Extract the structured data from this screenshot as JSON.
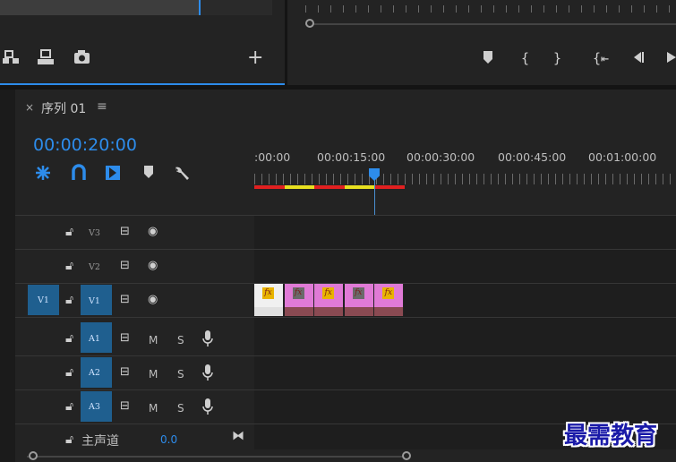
{
  "source_panel": {
    "toolbar_icons": [
      "insert-icon",
      "overwrite-icon",
      "export-frame-icon",
      "add-button-icon"
    ]
  },
  "program_panel": {
    "controls": [
      "marker-icon",
      "mark-in-icon",
      "mark-out-icon",
      "go-to-in-icon",
      "step-back-icon",
      "play-icon"
    ]
  },
  "timeline": {
    "tab": {
      "close": "×",
      "title": "序列 01",
      "menu": "≡"
    },
    "timecode": "00:00:20:00",
    "tools": [
      "nest-icon",
      "snap-icon",
      "linked-selection-icon",
      "add-marker-icon",
      "wrench-icon"
    ],
    "ruler_labels": [
      ":00:00",
      "00:00:15:00",
      "00:00:30:00",
      "00:00:45:00",
      "00:01:00:00"
    ],
    "playhead_time": "00:00:20:00",
    "video_tracks": [
      {
        "name": "V3",
        "source": ""
      },
      {
        "name": "V2",
        "source": ""
      },
      {
        "name": "V1",
        "source": "V1"
      }
    ],
    "audio_tracks": [
      {
        "name": "A1",
        "mute": "M",
        "solo": "S"
      },
      {
        "name": "A2",
        "mute": "M",
        "solo": "S"
      },
      {
        "name": "A3",
        "mute": "M",
        "solo": "S"
      }
    ],
    "master": {
      "label": "主声道",
      "value": "0.0"
    },
    "clips": [
      {
        "fx": "fx",
        "color": "#f0f0f0",
        "badge": "#e8b400"
      },
      {
        "fx": "fx",
        "color": "#e07ad6",
        "badge": "#6a6a6a"
      },
      {
        "fx": "fx",
        "color": "#e07ad6",
        "badge": "#e8b400"
      },
      {
        "fx": "fx",
        "color": "#e07ad6",
        "badge": "#6a6a6a"
      },
      {
        "fx": "fx",
        "color": "#e07ad6",
        "badge": "#e8b400"
      }
    ],
    "render_bar_colors": [
      "#e02020",
      "#e8e020",
      "#e02020",
      "#e8e020",
      "#e02020"
    ]
  },
  "watermark": "最需教育",
  "colors": {
    "accent": "#2d8ceb",
    "panel": "#232323",
    "target": "#1f5f8f"
  }
}
